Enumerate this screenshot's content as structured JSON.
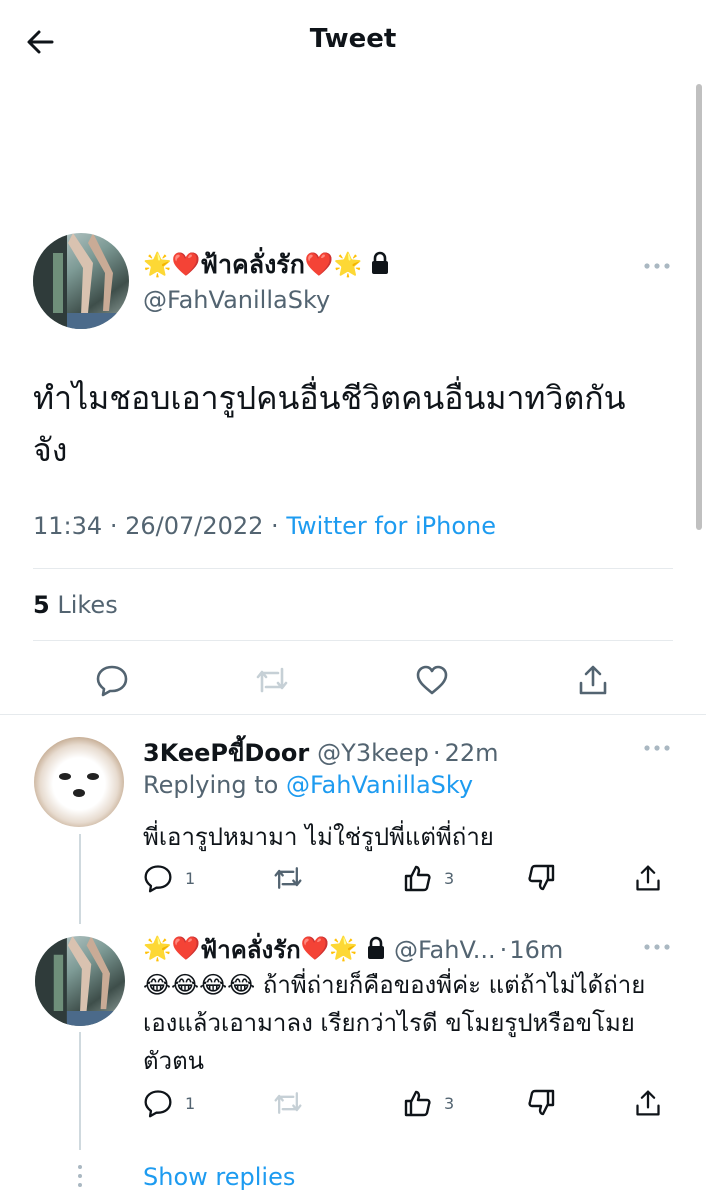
{
  "header": {
    "title": "Tweet"
  },
  "tweet": {
    "name_parts": {
      "prefix": "🌟❤️",
      "name": "ฟ้าคลั่งรัก",
      "suffix": "❤️🌟"
    },
    "handle": "@FahVanillaSky",
    "text": "ทำไมชอบเอารูปคนอื่นชีวิตคนอื่นมาทวิตกันจัง",
    "time": "11:34",
    "date": "26/07/2022",
    "source": "Twitter for iPhone",
    "likes_count": "5",
    "likes_label": "Likes"
  },
  "replies": [
    {
      "name": "3KeePขี้Door",
      "handle": "@Y3keep",
      "time": "22m",
      "replying_label": "Replying to",
      "replying_to": "@FahVanillaSky",
      "text": "พี่เอารูปหมามา ไม่ใช่รูปพี่แต่พี่ถ่าย",
      "reply_count": "1",
      "retweet_count": "",
      "like_count": "3"
    },
    {
      "name_parts": {
        "prefix": "🌟❤️",
        "name": "ฟ้าคลั่งรัก",
        "suffix": "❤️🌟"
      },
      "handle": "@FahV...",
      "time": "16m",
      "emoji_prefix": "😂😂😂😂",
      "text": "ถ้าพี่ถ่ายก็คือของพี่ค่ะ แต่ถ้าไม่ได้ถ่ายเองแล้วเอามาลง เรียกว่าไรดี ขโมยรูปหรือขโมยตัวตน",
      "reply_count": "1",
      "retweet_count": "",
      "like_count": "3"
    }
  ],
  "show_replies": "Show replies",
  "colors": {
    "accent": "#1d9bf0",
    "text": "#0f1419",
    "secondary": "#536471",
    "divider": "#e6eaed"
  },
  "icons": [
    "back-arrow-icon",
    "lock-icon",
    "more-icon",
    "reply-icon",
    "retweet-icon",
    "like-icon",
    "dislike-icon",
    "share-icon"
  ]
}
